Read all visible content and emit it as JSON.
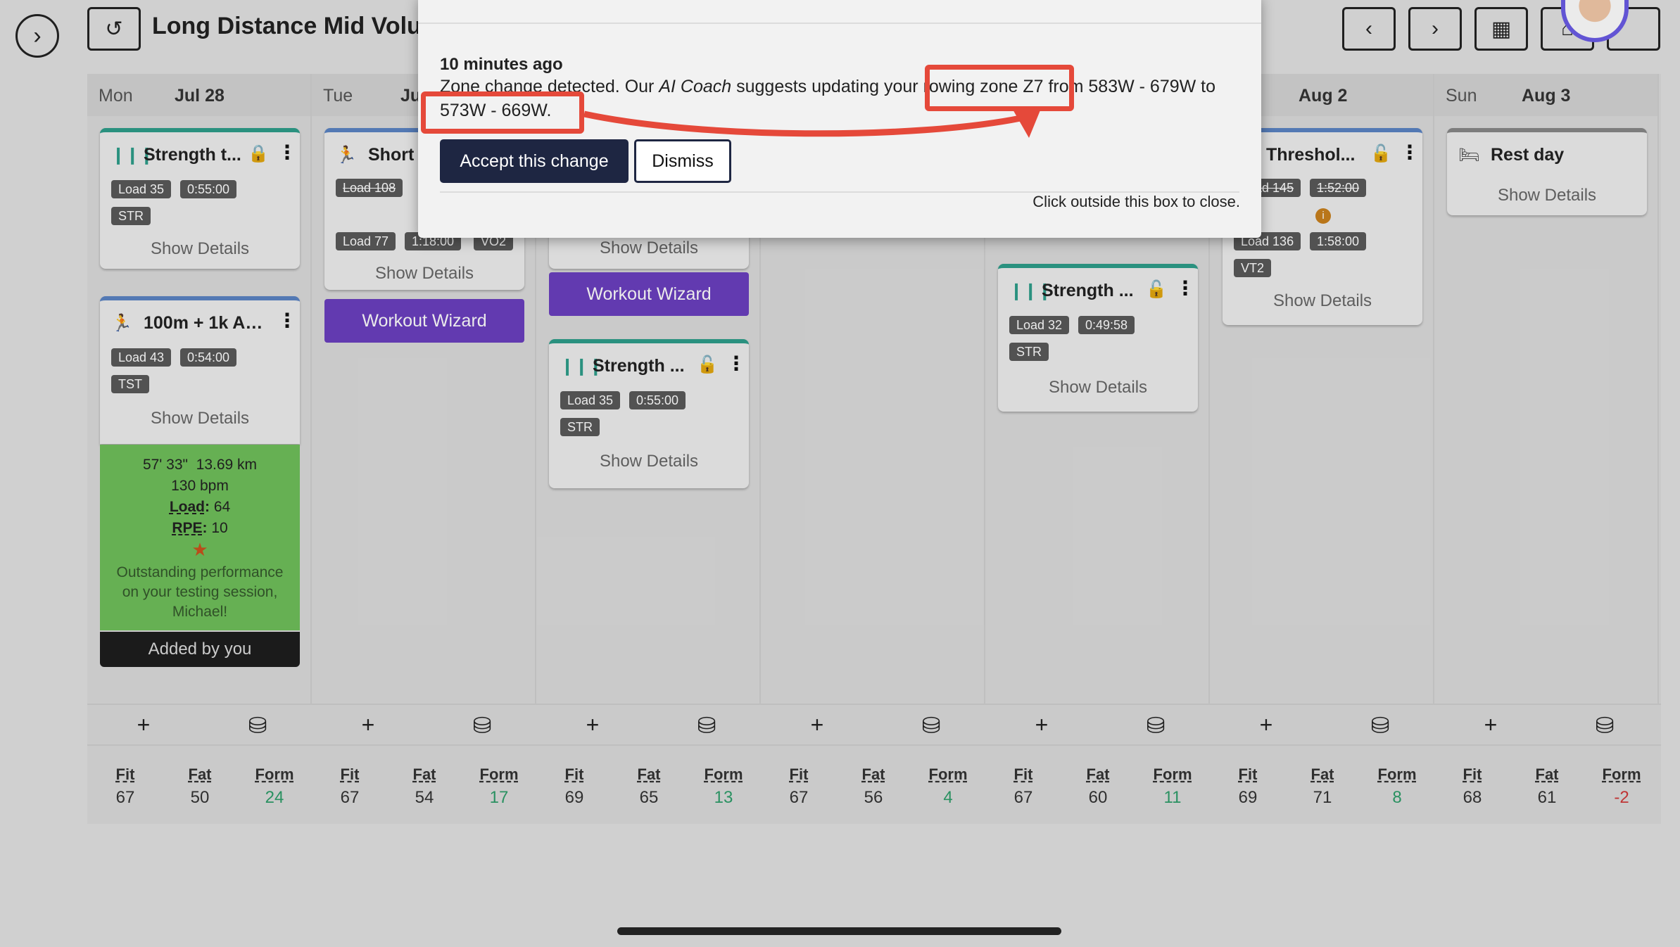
{
  "header": {
    "title": "Long Distance Mid Volu",
    "expand_icon": "chevron-right-circle-icon",
    "history_icon": "history-icon",
    "prev_icon": "chevron-left-icon",
    "next_icon": "chevron-right-icon",
    "calendar_icon": "calendar-icon",
    "home_icon": "home-icon"
  },
  "days": [
    {
      "name": "Mon",
      "date": "Jul 28"
    },
    {
      "name": "Tue",
      "date": "Ju"
    },
    {
      "name": "",
      "date": ""
    },
    {
      "name": "",
      "date": ""
    },
    {
      "name": "",
      "date": ""
    },
    {
      "name": "",
      "date": "Aug 2"
    },
    {
      "name": "Sun",
      "date": "Aug 3"
    }
  ],
  "cards": {
    "mon1": {
      "title": "Strength t...",
      "load": "Load 35",
      "duration": "0:55:00",
      "tag": "STR",
      "details": "Show Details"
    },
    "mon2": {
      "title": "100m + 1k AL...",
      "load": "Load 43",
      "duration": "0:54:00",
      "tag": "TST",
      "details": "Show Details",
      "result": {
        "time": "57' 33\"",
        "distance": "13.69 km",
        "hr": "130 bpm",
        "load_label": "Load",
        "load": "64",
        "rpe_label": "RPE",
        "rpe": "10",
        "comment": "Outstanding performance on your testing session, Michael!"
      },
      "added_by": "Added by you"
    },
    "tue1": {
      "title": "Short",
      "old_load": "Load 108",
      "load": "Load 77",
      "duration": "1:18:00",
      "tag": "VO2",
      "details": "Show Details",
      "wizard": "Workout Wizard"
    },
    "wed0": {
      "details": "Show Details",
      "wizard": "Workout Wizard"
    },
    "wed1": {
      "title": "Strength ...",
      "load": "Load 35",
      "duration": "0:55:00",
      "tag": "STR",
      "details": "Show Details"
    },
    "fri1": {
      "title": "Strength ...",
      "load": "Load 32",
      "duration": "0:49:58",
      "tag": "STR",
      "details": "Show Details"
    },
    "sat1": {
      "title": "Threshol...",
      "old_load": "Load 145",
      "old_duration": "1:52:00",
      "load": "Load 136",
      "duration": "1:58:00",
      "tag": "VT2",
      "details": "Show Details"
    },
    "sun1": {
      "title": "Rest day",
      "details": "Show Details"
    }
  },
  "stats": [
    {
      "fit": "67",
      "fat": "50",
      "form": "24"
    },
    {
      "fit": "67",
      "fat": "54",
      "form": "17"
    },
    {
      "fit": "69",
      "fat": "65",
      "form": "13"
    },
    {
      "fit": "67",
      "fat": "56",
      "form": "4"
    },
    {
      "fit": "67",
      "fat": "60",
      "form": "11"
    },
    {
      "fit": "69",
      "fat": "71",
      "form": "8"
    },
    {
      "fit": "68",
      "fat": "61",
      "form": "-2"
    }
  ],
  "stat_labels": {
    "fit": "Fit",
    "fat": "Fat",
    "form": "Form"
  },
  "popup": {
    "time": "10 minutes ago",
    "msg_1": "Zone change detected. Our ",
    "msg_coach": "AI Coach",
    "msg_2": " suggests updating your rowing zone Z7 from 583W - 679W to 573W - 669W.",
    "accept": "Accept this change",
    "dismiss": "Dismiss",
    "close_hint": "Click outside this box to close."
  },
  "colors": {
    "accent_dark": "#1e2642",
    "wizard": "#6b3fbf",
    "highlight": "#e5493a",
    "result_green": "#6fbf5b"
  }
}
